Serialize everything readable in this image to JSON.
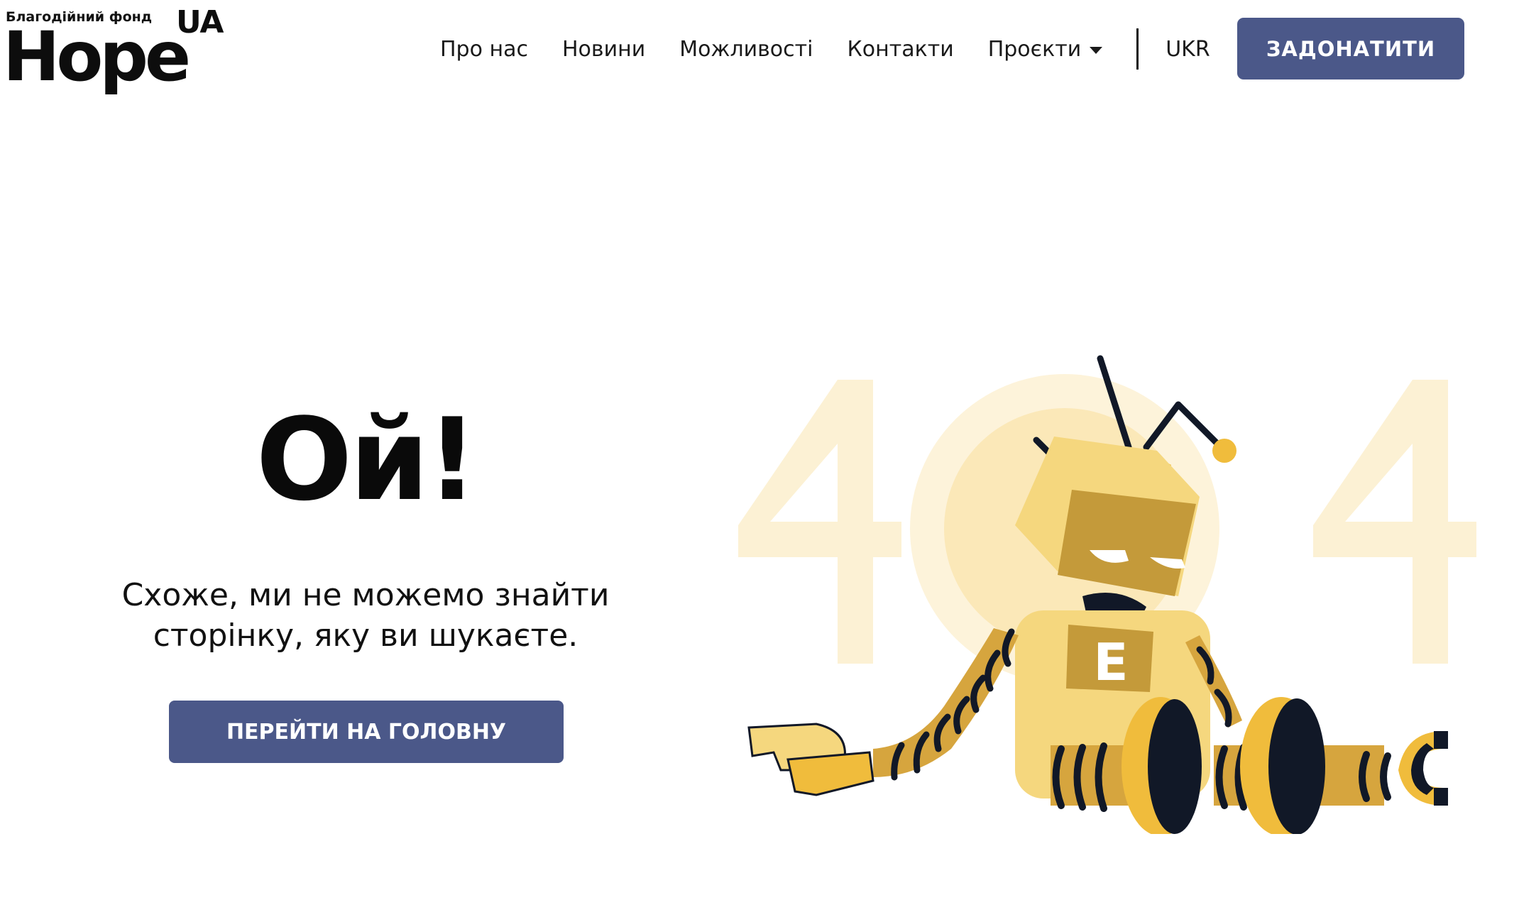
{
  "header": {
    "logo": {
      "subtitle": "Благодійний фонд",
      "name": "Hope",
      "suffix": "UA"
    },
    "nav": [
      {
        "label": "Про нас"
      },
      {
        "label": "Новини"
      },
      {
        "label": "Можливості"
      },
      {
        "label": "Контакти"
      },
      {
        "label": "Проєкти",
        "has_dropdown": true
      }
    ],
    "language": "UKR",
    "donate_label": "ЗАДОНАТИТИ"
  },
  "error_page": {
    "title": "Ой!",
    "message_line1": "Схоже, ми не можемо знайти",
    "message_line2": "сторінку, яку ви шукаєте.",
    "home_button": "ПЕРЕЙТИ НА ГОЛОВНУ",
    "illustration": {
      "digits": "4 0 4",
      "robot_badge": "E"
    }
  },
  "colors": {
    "accent": "#4b5889",
    "robot_light": "#f5d77e",
    "robot_mid": "#c49a3a",
    "robot_yellow": "#f0bc3c",
    "robot_dark": "#111827",
    "digits_faint": "#fcf1d4"
  }
}
